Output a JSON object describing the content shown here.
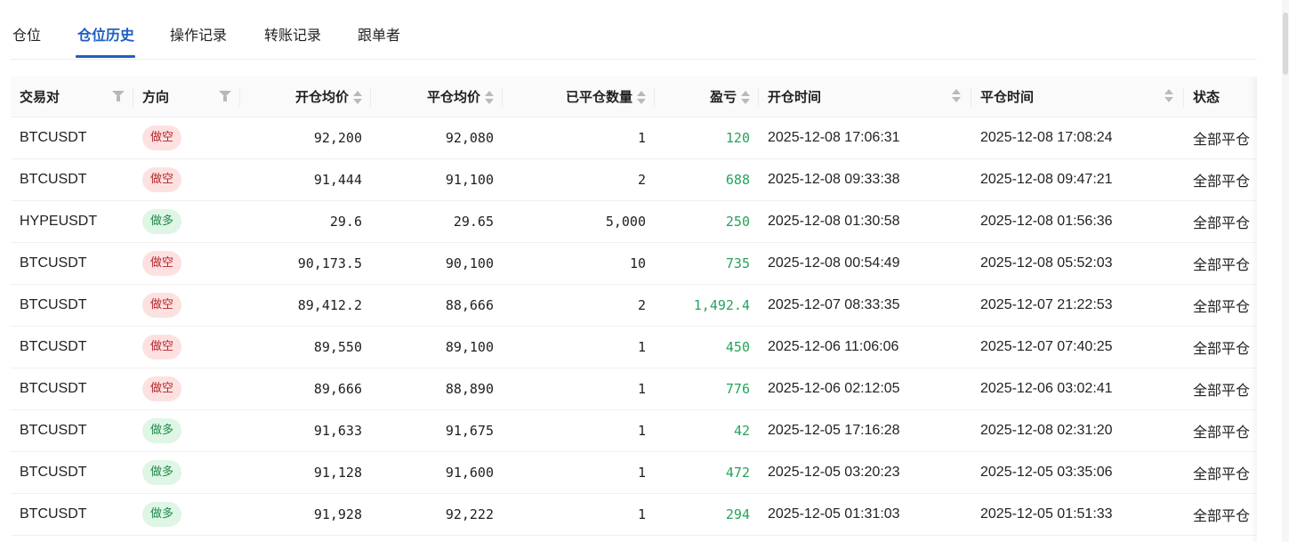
{
  "tabs": [
    {
      "label": "仓位"
    },
    {
      "label": "仓位历史"
    },
    {
      "label": "操作记录"
    },
    {
      "label": "转账记录"
    },
    {
      "label": "跟单者"
    }
  ],
  "active_tab": "仓位历史",
  "columns": {
    "symbol": "交易对",
    "side": "方向",
    "open_avg": "开仓均价",
    "close_avg": "平仓均价",
    "closed_qty": "已平仓数量",
    "pnl": "盈亏",
    "open_time": "开仓时间",
    "close_time": "平仓时间",
    "status": "状态"
  },
  "colors": {
    "accent": "#1f5fbf",
    "profit": "#26a35a",
    "short_bg": "#fde1e1",
    "short_fg": "#b3272b",
    "long_bg": "#dff5e6",
    "long_fg": "#1e8a4a"
  },
  "rows": [
    {
      "symbol": "BTCUSDT",
      "side": "做空",
      "side_type": "short",
      "open_avg": "92,200",
      "close_avg": "92,080",
      "qty": "1",
      "pnl": "120",
      "open_time": "2025-12-08 17:06:31",
      "close_time": "2025-12-08 17:08:24",
      "status": "全部平仓"
    },
    {
      "symbol": "BTCUSDT",
      "side": "做空",
      "side_type": "short",
      "open_avg": "91,444",
      "close_avg": "91,100",
      "qty": "2",
      "pnl": "688",
      "open_time": "2025-12-08 09:33:38",
      "close_time": "2025-12-08 09:47:21",
      "status": "全部平仓"
    },
    {
      "symbol": "HYPEUSDT",
      "side": "做多",
      "side_type": "long",
      "open_avg": "29.6",
      "close_avg": "29.65",
      "qty": "5,000",
      "pnl": "250",
      "open_time": "2025-12-08 01:30:58",
      "close_time": "2025-12-08 01:56:36",
      "status": "全部平仓"
    },
    {
      "symbol": "BTCUSDT",
      "side": "做空",
      "side_type": "short",
      "open_avg": "90,173.5",
      "close_avg": "90,100",
      "qty": "10",
      "pnl": "735",
      "open_time": "2025-12-08 00:54:49",
      "close_time": "2025-12-08 05:52:03",
      "status": "全部平仓"
    },
    {
      "symbol": "BTCUSDT",
      "side": "做空",
      "side_type": "short",
      "open_avg": "89,412.2",
      "close_avg": "88,666",
      "qty": "2",
      "pnl": "1,492.4",
      "open_time": "2025-12-07 08:33:35",
      "close_time": "2025-12-07 21:22:53",
      "status": "全部平仓"
    },
    {
      "symbol": "BTCUSDT",
      "side": "做空",
      "side_type": "short",
      "open_avg": "89,550",
      "close_avg": "89,100",
      "qty": "1",
      "pnl": "450",
      "open_time": "2025-12-06 11:06:06",
      "close_time": "2025-12-07 07:40:25",
      "status": "全部平仓"
    },
    {
      "symbol": "BTCUSDT",
      "side": "做空",
      "side_type": "short",
      "open_avg": "89,666",
      "close_avg": "88,890",
      "qty": "1",
      "pnl": "776",
      "open_time": "2025-12-06 02:12:05",
      "close_time": "2025-12-06 03:02:41",
      "status": "全部平仓"
    },
    {
      "symbol": "BTCUSDT",
      "side": "做多",
      "side_type": "long",
      "open_avg": "91,633",
      "close_avg": "91,675",
      "qty": "1",
      "pnl": "42",
      "open_time": "2025-12-05 17:16:28",
      "close_time": "2025-12-08 02:31:20",
      "status": "全部平仓"
    },
    {
      "symbol": "BTCUSDT",
      "side": "做多",
      "side_type": "long",
      "open_avg": "91,128",
      "close_avg": "91,600",
      "qty": "1",
      "pnl": "472",
      "open_time": "2025-12-05 03:20:23",
      "close_time": "2025-12-05 03:35:06",
      "status": "全部平仓"
    },
    {
      "symbol": "BTCUSDT",
      "side": "做多",
      "side_type": "long",
      "open_avg": "91,928",
      "close_avg": "92,222",
      "qty": "1",
      "pnl": "294",
      "open_time": "2025-12-05 01:31:03",
      "close_time": "2025-12-05 01:51:33",
      "status": "全部平仓"
    }
  ]
}
